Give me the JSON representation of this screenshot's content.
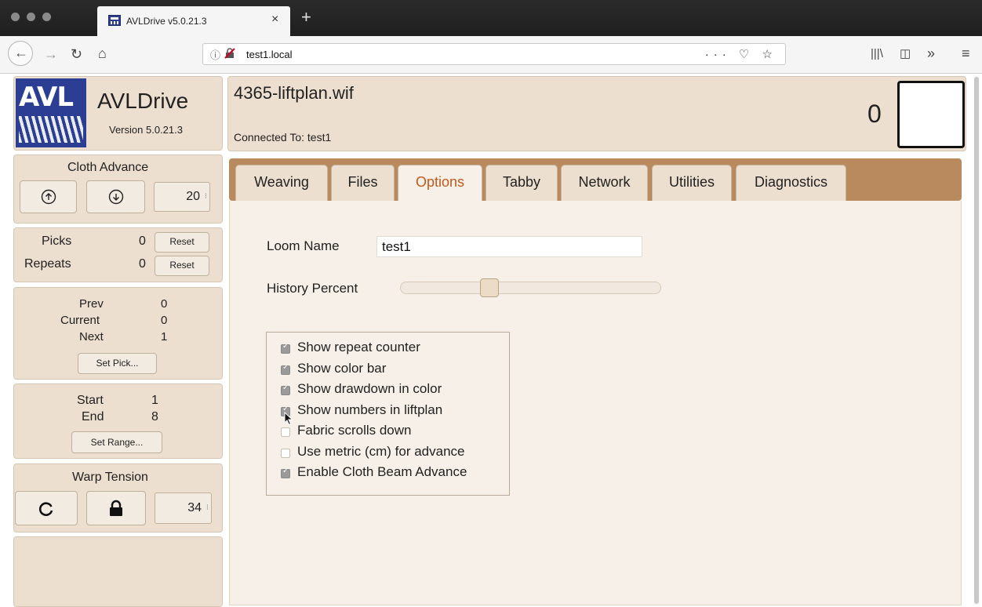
{
  "browser": {
    "tab_title": "AVLDrive v5.0.21.3",
    "tab_close": "×",
    "new_tab": "+",
    "url": "test1.local",
    "url_actions": "··· ♡ ☆",
    "right_icons": [
      "library-icon",
      "sidebar-icon",
      "overflow-icon",
      "menu-icon"
    ]
  },
  "app": {
    "logo_text": "AVL",
    "title": "AVLDrive",
    "version": "Version 5.0.21.3",
    "file_name": "4365-liftplan.wif",
    "connected_to": "Connected To: test1",
    "pick_counter": "0"
  },
  "cloth_advance": {
    "title": "Cloth Advance",
    "value": "20"
  },
  "counts": {
    "picks_label": "Picks",
    "picks_value": "0",
    "repeats_label": "Repeats",
    "repeats_value": "0",
    "reset_label": "Reset"
  },
  "pick_nav": {
    "prev_label": "Prev",
    "prev_value": "0",
    "current_label": "Current",
    "current_value": "0",
    "next_label": "Next",
    "next_value": "1",
    "set_pick_label": "Set Pick..."
  },
  "range": {
    "start_label": "Start",
    "start_value": "1",
    "end_label": "End",
    "end_value": "8",
    "set_range_label": "Set Range..."
  },
  "warp_tension": {
    "title": "Warp Tension",
    "value": "34"
  },
  "tabs": [
    "Weaving",
    "Files",
    "Options",
    "Tabby",
    "Network",
    "Utilities",
    "Diagnostics"
  ],
  "active_tab": "Options",
  "options": {
    "loom_name_label": "Loom Name",
    "loom_name_value": "test1",
    "history_percent_label": "History Percent",
    "history_percent_value": 0.33,
    "checkboxes": [
      {
        "label": "Show repeat counter",
        "checked": true
      },
      {
        "label": "Show color bar",
        "checked": true
      },
      {
        "label": "Show drawdown in color",
        "checked": true
      },
      {
        "label": "Show numbers in liftplan",
        "checked": true
      },
      {
        "label": "Fabric scrolls down",
        "checked": false
      },
      {
        "label": "Use metric (cm) for advance",
        "checked": false
      },
      {
        "label": "Enable Cloth Beam Advance",
        "checked": true
      }
    ]
  },
  "colors": {
    "panel_bg": "#ecdfcf",
    "tab_strip": "#b98a5d",
    "active_tab_text": "#c05a1c",
    "logo_blue": "#2c3e93"
  }
}
